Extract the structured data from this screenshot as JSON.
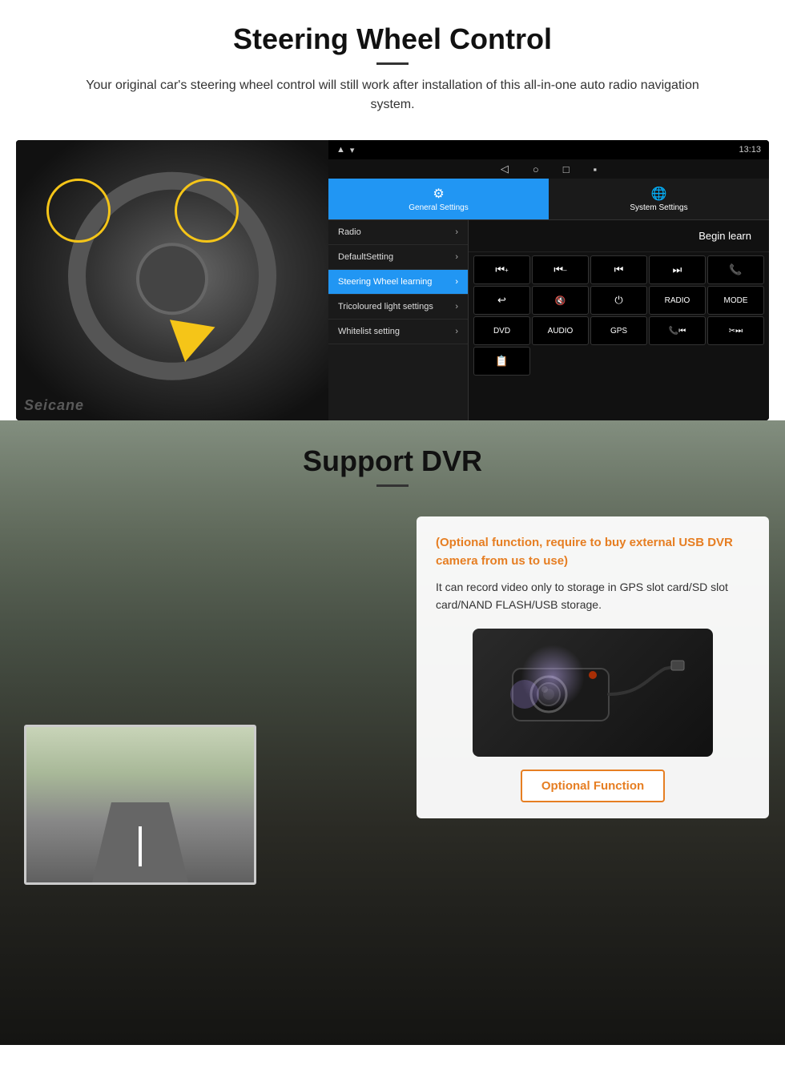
{
  "steering_section": {
    "title": "Steering Wheel Control",
    "subtitle": "Your original car's steering wheel control will still work after installation of this all-in-one auto radio navigation system.",
    "divider": "—",
    "android": {
      "status_bar": {
        "time": "13:13",
        "signal_icon": "signal",
        "wifi_icon": "wifi",
        "battery_icon": "battery"
      },
      "nav_icons": [
        "back",
        "home",
        "square",
        "menu"
      ],
      "tabs": [
        {
          "id": "general",
          "label": "General Settings",
          "icon": "⚙"
        },
        {
          "id": "system",
          "label": "System Settings",
          "icon": "🌐"
        }
      ],
      "menu_items": [
        {
          "label": "Radio",
          "active": false
        },
        {
          "label": "DefaultSetting",
          "active": false
        },
        {
          "label": "Steering Wheel learning",
          "active": true
        },
        {
          "label": "Tricoloured light settings",
          "active": false
        },
        {
          "label": "Whitelist setting",
          "active": false
        }
      ],
      "begin_learn": "Begin learn",
      "control_buttons": [
        "⏮+",
        "⏮–",
        "⏮⏮",
        "⏭⏭",
        "📞",
        "↩",
        "🔇",
        "⏻",
        "RADIO",
        "MODE",
        "DVD",
        "AUDIO",
        "GPS",
        "📞⏮",
        "✂⏭"
      ],
      "extra_button": "📋"
    }
  },
  "dvr_section": {
    "title": "Support DVR",
    "divider": "—",
    "optional_notice": "(Optional function, require to buy external USB DVR camera from us to use)",
    "body_text": "It can record video only to storage in GPS slot card/SD slot card/NAND FLASH/USB storage.",
    "optional_function_label": "Optional Function"
  }
}
